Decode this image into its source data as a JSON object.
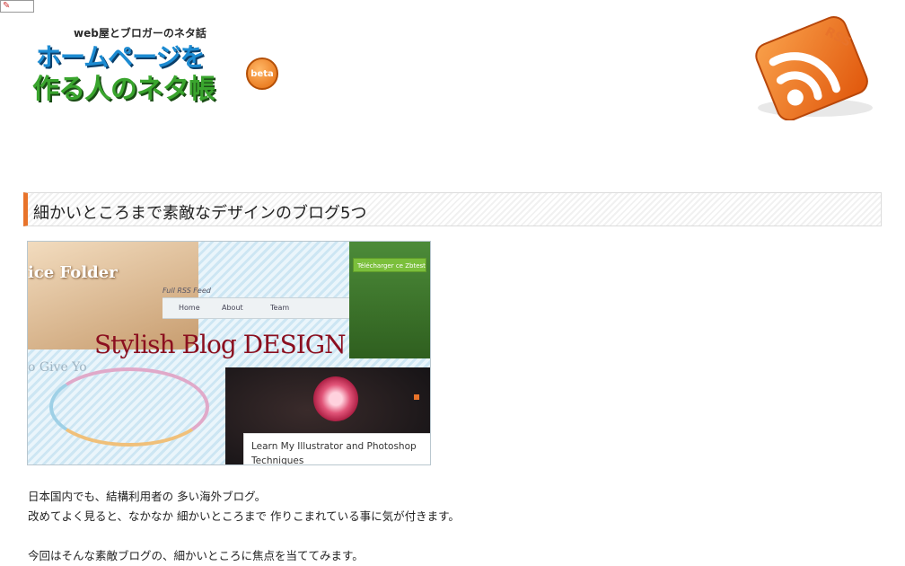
{
  "header": {
    "tagline": "web屋とブロガーのネタ話",
    "logo_line1": "ホームページを",
    "logo_line2": "作る人のネタ帳",
    "logo_badge": "beta",
    "rss_label": "RSS"
  },
  "article": {
    "title": "細かいところまで素敵なデザインのブログ5つ",
    "hero": {
      "folder_text": "ice Folder",
      "rss_feed": "Full RSS Feed",
      "nav_items": [
        "Home",
        "About",
        "Team"
      ],
      "download_label": "Télécharger ce Zbtest",
      "headline": "Stylish Blog DESIGN",
      "ghost_left": "o Give Yo",
      "caption_line1": "Learn My Illustrator and Photoshop",
      "caption_line2": "Techniques"
    },
    "paragraphs": [
      "日本国内でも、結構利用者の 多い海外ブログ。",
      "改めてよく見ると、なかなか 細かいところまで 作りこまれている事に気が付きます。",
      "",
      "今回はそんな素敵ブログの、細かいところに焦点を当ててみます。"
    ]
  },
  "colors": {
    "accent": "#e8732a",
    "logo_blue": "#1c8bd2",
    "logo_green": "#3aa52e",
    "headline_red": "#8b0f1f"
  }
}
